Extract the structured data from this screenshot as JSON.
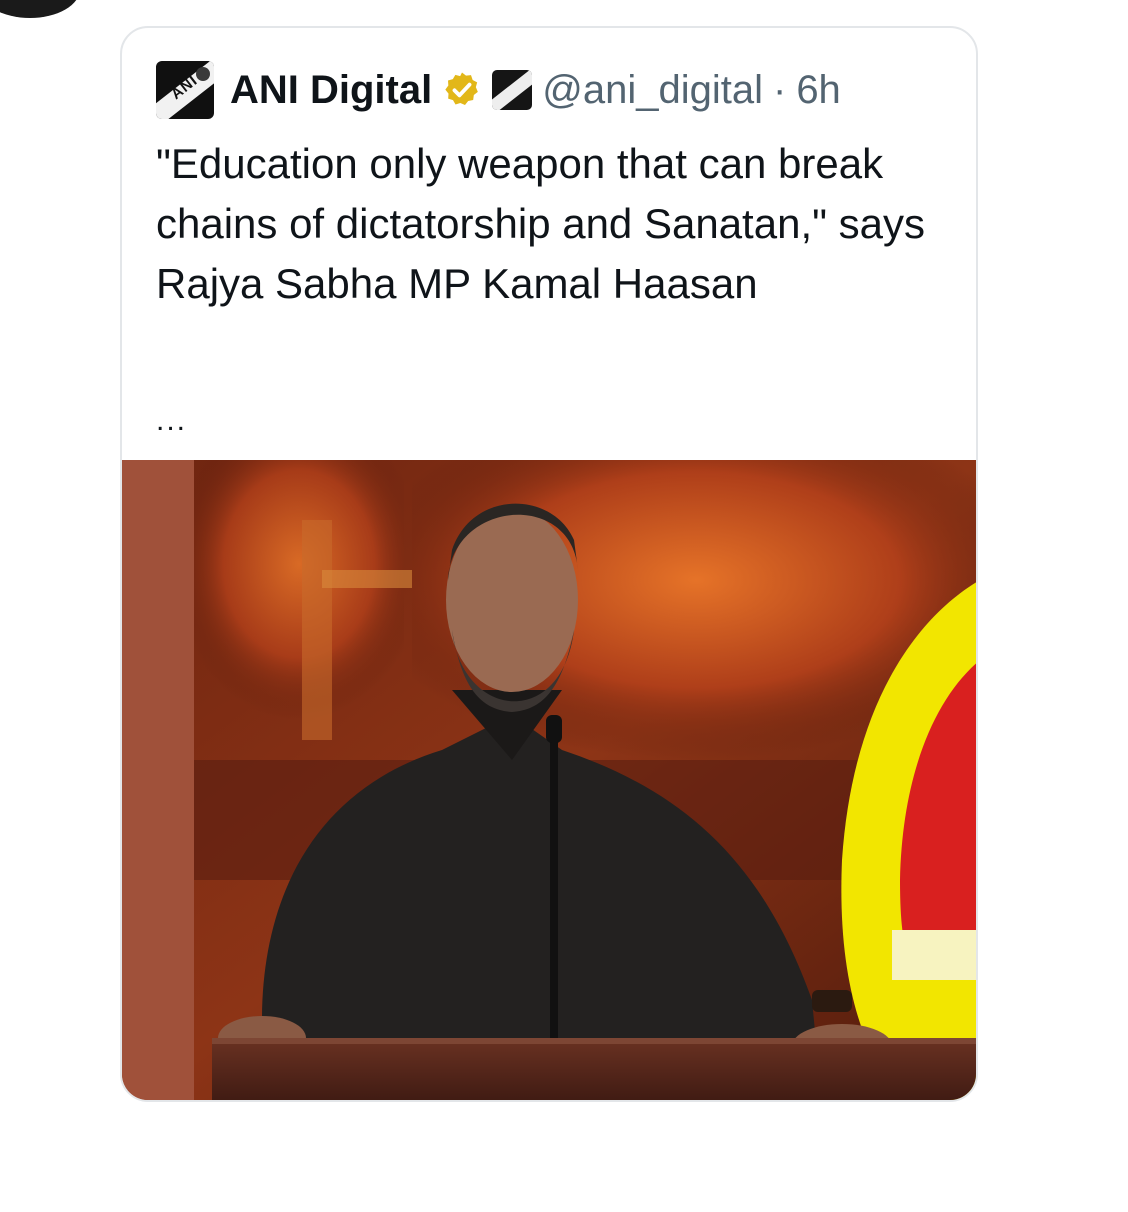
{
  "tweet": {
    "author_name": "ANI Digital",
    "handle": "@ani_digital",
    "separator": "·",
    "time": "6h",
    "text": "\"Education only weapon that can break chains of dictatorship and Sanatan,\" says Rajya Sabha MP Kamal Haasan",
    "more": "...",
    "logo_text": "ANI",
    "verified_color": "#e2b719"
  },
  "media": {
    "icon": "photo",
    "description_colors": {
      "background": "#7a2a12",
      "fire": "#d8541e",
      "yellow": "#f2e600",
      "red": "#d9201f"
    }
  }
}
